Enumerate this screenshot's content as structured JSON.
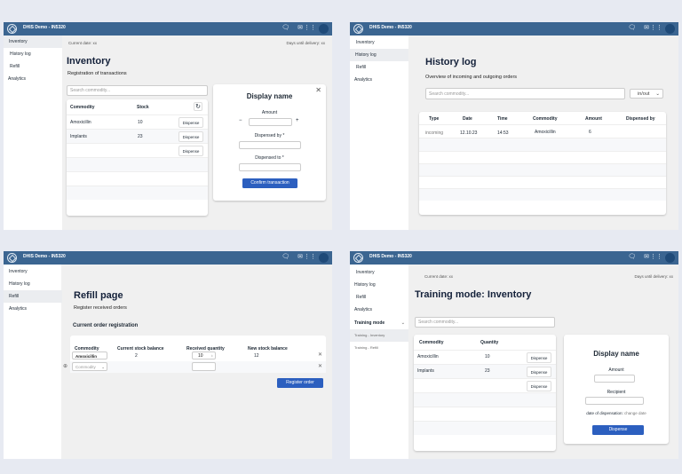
{
  "app": {
    "title": "DHIS Demo - IN5320",
    "icons": [
      "chat-icon",
      "mail-icon",
      "apps-grid-icon",
      "avatar"
    ]
  },
  "colors": {
    "header": "#3b6591",
    "primary_button": "#2c5fbf"
  },
  "sidebar": {
    "items": [
      "Inventory",
      "History log",
      "Refill",
      "Analytics"
    ],
    "training_mode": "Training mode",
    "training_items": [
      "Training - Inventory",
      "Training - Refill"
    ]
  },
  "inventory": {
    "current_date": "Current date: xx",
    "days_until": "Days until delivery: xx",
    "title": "Inventory",
    "subtitle": "Registration of transactions",
    "search_placeholder": "Search commodity...",
    "columns": [
      "Commodity",
      "Stock"
    ],
    "rows": [
      {
        "commodity": "Amoxicillin",
        "stock": "10"
      },
      {
        "commodity": "Implants",
        "stock": "23"
      }
    ],
    "dispense": "Dispense",
    "dialog": {
      "title": "Display name",
      "amount": "Amount",
      "minus": "−",
      "plus": "+",
      "dispensed_by": "Dispensed by *",
      "dispensed_to": "Dispensed to *",
      "confirm": "Confirm transaction"
    }
  },
  "history": {
    "title": "History log",
    "subtitle": "Overview of incoming and outgoing orders",
    "search_placeholder": "Search commodity...",
    "filter": "in/out",
    "columns": [
      "Type",
      "Date",
      "Time",
      "Commodity",
      "Amount",
      "Dispensed by"
    ],
    "rows": [
      [
        "incoming",
        "12.10.23",
        "14:53",
        "Amoxicillin",
        "6",
        ""
      ]
    ]
  },
  "refill": {
    "title": "Refill page",
    "subtitle": "Register received orders",
    "section": "Current order registration",
    "columns": [
      "Commodity",
      "Current stock balance",
      "Received quantity",
      "New stock balance"
    ],
    "row": {
      "commodity": "Amoxicillin",
      "current": "2",
      "received": "10",
      "new": "12"
    },
    "commodity_placeholder": "Commodity",
    "register": "Register order"
  },
  "training": {
    "current_date": "Current date: xx",
    "days_until": "Days until delivery: xx",
    "title": "Training mode: Inventory",
    "search_placeholder": "Search commodity...",
    "columns": [
      "Commodity",
      "Quantity"
    ],
    "rows": [
      {
        "commodity": "Amoxicillin",
        "qty": "10"
      },
      {
        "commodity": "Implants",
        "qty": "23"
      }
    ],
    "dispense": "Dispense",
    "dialog": {
      "title": "Display name",
      "amount": "Amount",
      "recipient": "Recipient",
      "date_label": "date of dispensation:",
      "change_date": "change date",
      "dispense": "Dispense"
    }
  }
}
